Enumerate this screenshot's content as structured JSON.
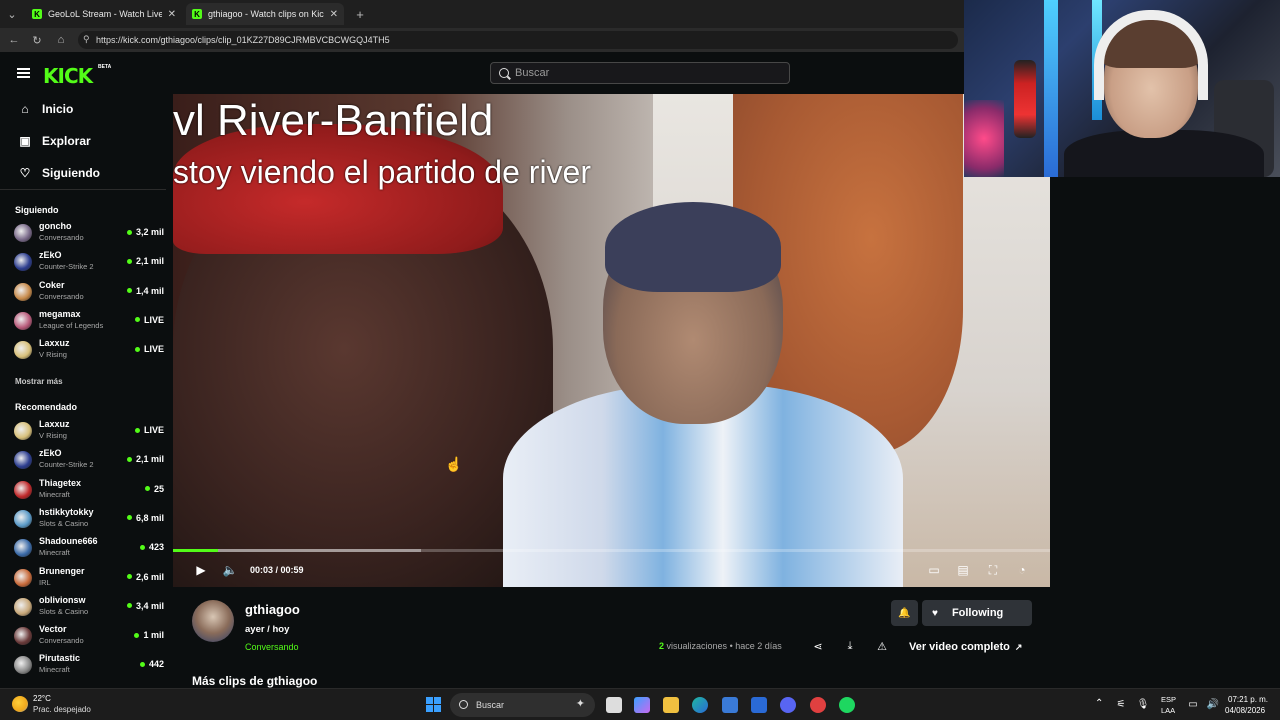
{
  "browser": {
    "tabs": [
      {
        "title": "GeoLoL Stream - Watch Live o",
        "active": false
      },
      {
        "title": "gthiagoo - Watch clips on Kick",
        "active": true
      }
    ],
    "new_tab": "+",
    "url": "https://kick.com/gthiagoo/clips/clip_01KZ27D89CJRMBVCBCWGQJ4TH5"
  },
  "header": {
    "logo": "KICK",
    "logo_badge": "BETA",
    "search_placeholder": "Buscar"
  },
  "sidebar": {
    "nav": [
      {
        "label": "Inicio",
        "icon": "home-icon"
      },
      {
        "label": "Explorar",
        "icon": "compass-icon"
      },
      {
        "label": "Siguiendo",
        "icon": "heart-icon"
      }
    ],
    "following_title": "Siguiendo",
    "following": [
      {
        "name": "goncho",
        "category": "Conversando",
        "count": "3,2 mil",
        "color": "#7a6a8a"
      },
      {
        "name": "zEkO",
        "category": "Counter-Strike 2",
        "count": "2,1 mil",
        "color": "#2c3d8f"
      },
      {
        "name": "Coker",
        "category": "Conversando",
        "count": "1,4 mil",
        "color": "#c78a4a"
      },
      {
        "name": "megamax",
        "category": "League of Legends",
        "count": "LIVE",
        "color": "#b85a7a"
      },
      {
        "name": "Laxxuz",
        "category": "V Rising",
        "count": "LIVE",
        "color": "#d8c07a"
      }
    ],
    "show_more": "Mostrar más",
    "recommended_title": "Recomendado",
    "recommended": [
      {
        "name": "Laxxuz",
        "category": "V Rising",
        "count": "LIVE",
        "color": "#d8c07a"
      },
      {
        "name": "zEkO",
        "category": "Counter-Strike 2",
        "count": "2,1 mil",
        "color": "#2c3d8f"
      },
      {
        "name": "Thiagetex",
        "category": "Minecraft",
        "count": "25",
        "color": "#c0282a"
      },
      {
        "name": "hstikkytokky",
        "category": "Slots & Casino",
        "count": "6,8 mil",
        "color": "#5a9ac8"
      },
      {
        "name": "Shadoune666",
        "category": "Minecraft",
        "count": "423",
        "color": "#3a6aa8"
      },
      {
        "name": "Brunenger",
        "category": "IRL",
        "count": "2,6 mil",
        "color": "#c86a3a"
      },
      {
        "name": "oblivionsw",
        "category": "Slots & Casino",
        "count": "3,4 mil",
        "color": "#c8a87a"
      },
      {
        "name": "Vector",
        "category": "Conversando",
        "count": "1 mil",
        "color": "#6a3a3a"
      },
      {
        "name": "Pirutastic",
        "category": "Minecraft",
        "count": "442",
        "color": "#8a8a8a"
      }
    ]
  },
  "video": {
    "overlay_line1": "vl River-Banfield",
    "overlay_line2": "stoy viendo el partido de river",
    "time": "00:03 / 00:59",
    "progress": 0.051,
    "buffered": 0.283
  },
  "clip": {
    "channel": "gthiagoo",
    "title": "ayer / hoy",
    "category": "Conversando",
    "views_count": "2",
    "views_label": "visualizaciones",
    "age": "hace 2 días",
    "follow_label": "Following",
    "full_video_label": "Ver video completo",
    "more_clips": "Más clips de gthiagoo"
  },
  "taskbar": {
    "temp": "22°C",
    "weather": "Prac. despejado",
    "search": "Buscar",
    "lang1": "ESP",
    "lang2": "LAA",
    "time": "07:21 p. m.",
    "date": "04/08/2026"
  },
  "colors": {
    "accent": "#53fc18",
    "background": "#0b0e0f",
    "button": "#2f3338"
  }
}
